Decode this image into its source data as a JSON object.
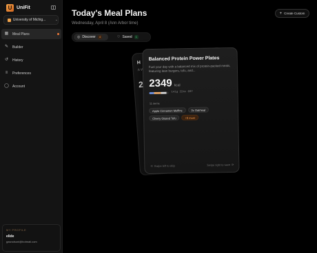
{
  "brand": {
    "name": "UniFit",
    "logo": "U"
  },
  "school": {
    "label": "University of Michig...",
    "icon": "school-icon"
  },
  "nav": [
    {
      "label": "Meal Plans",
      "icon": "grid-icon",
      "glyph": "▦"
    },
    {
      "label": "Builder",
      "icon": "pencil-icon",
      "glyph": "✎"
    },
    {
      "label": "History",
      "icon": "history-icon",
      "glyph": "↺"
    },
    {
      "label": "Preferences",
      "icon": "sliders-icon",
      "glyph": "≡"
    },
    {
      "label": "Account",
      "icon": "user-icon",
      "glyph": "◯"
    }
  ],
  "profile": {
    "heading": "MY PROFILE",
    "name": "elide",
    "email": "gasnolsoni@hotmail.com"
  },
  "header": {
    "title": "Today's Meal Plans",
    "date": "Wednesday, April 8",
    "timezone": "(Ann Arbor time)",
    "create_label": "Create Custom"
  },
  "tabs": [
    {
      "label": "Discover",
      "count": "4"
    },
    {
      "label": "Saved",
      "count": "1"
    }
  ],
  "back_card": {
    "title": "H",
    "desc": "A\nW",
    "kcal": "2"
  },
  "card": {
    "title": "Balanced Protein Power Plates",
    "description": "Fuel your day with a balanced mix of protein-packed meals, featuring lean burgers, tofu, and...",
    "kcal": "2349",
    "kcal_unit": "kcal",
    "macros": "141g  224c  60f",
    "items_count": "11 items",
    "tags": [
      "Apple Cinnamon Muffins",
      "2x Oatmeal",
      "Cherry Glazed Tofu"
    ],
    "more_tag": "+8 more",
    "foot_left": "Swipe left to skip",
    "foot_right": "Swipe right to save",
    "macro_fractions": {
      "protein": 0.24,
      "carbs": 0.38,
      "fat": 0.26
    }
  },
  "colors": {
    "accent": "#f07a3a",
    "brand": "#f0a24a",
    "saved": "#4ad07a"
  }
}
